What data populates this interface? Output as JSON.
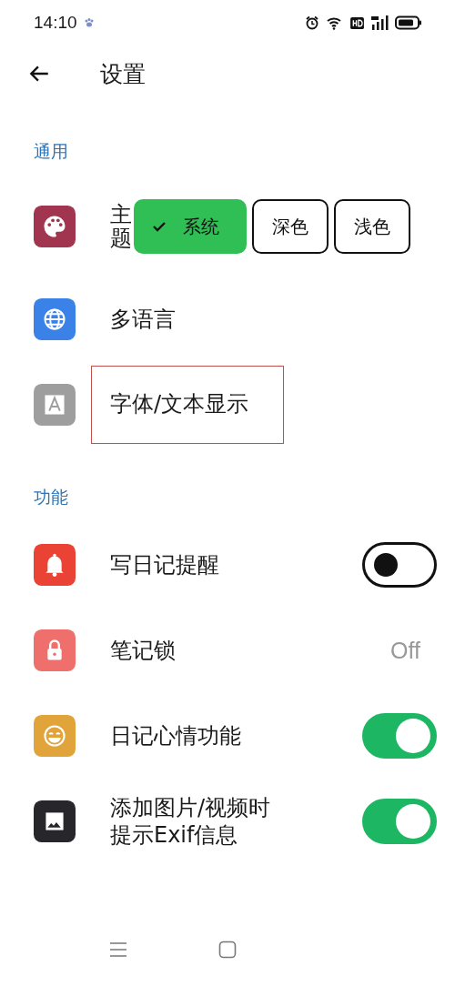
{
  "status_bar": {
    "time": "14:10"
  },
  "header": {
    "title": "设置"
  },
  "sections": [
    {
      "title": "通用",
      "items": [
        {
          "kind": "segmented",
          "label": "主题",
          "color": "#a1344e",
          "options": [
            {
              "label": "系统",
              "selected": true
            },
            {
              "label": "深色",
              "selected": false
            },
            {
              "label": "浅色",
              "selected": false
            }
          ]
        },
        {
          "kind": "link",
          "label": "多语言",
          "color": "#3b82e8",
          "highlighted": false
        },
        {
          "kind": "link",
          "label": "字体/文本显示",
          "color": "#9e9e9e",
          "highlighted": true
        }
      ]
    },
    {
      "title": "功能",
      "items": [
        {
          "kind": "toggle",
          "label": "写日记提醒",
          "color": "#ea4335",
          "on": false
        },
        {
          "kind": "value",
          "label": "笔记锁",
          "color": "#ef6f6c",
          "value": "Off"
        },
        {
          "kind": "toggle",
          "label": "日记心情功能",
          "color": "#e0a43a",
          "on": true
        },
        {
          "kind": "toggle",
          "label": "添加图片/视频时提示Exif信息",
          "color": "#26262b",
          "on": true
        }
      ]
    }
  ]
}
